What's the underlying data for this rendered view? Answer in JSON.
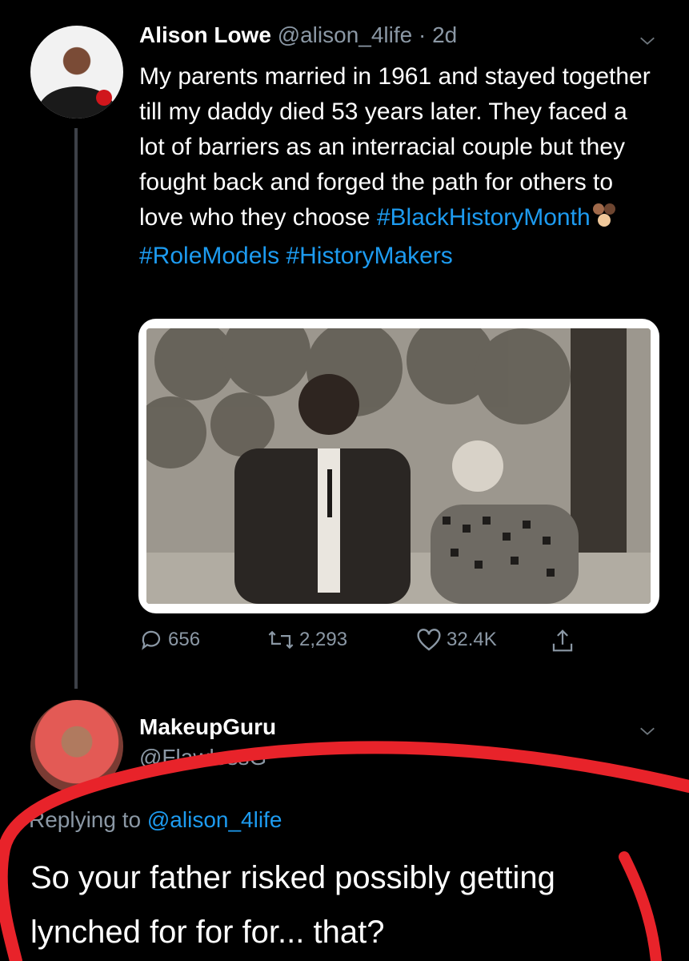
{
  "tweet": {
    "author_name": "Alison Lowe",
    "handle": "@alison_4life",
    "time": "· 2d",
    "text_before": "My parents married in 1961 and stayed together till my daddy died 53 years later. They faced a lot of barriers as an interracial couple but they fought back and forged the path for others to love who they choose ",
    "hashtag1": "#BlackHistoryMonth",
    "emoji": "✊🏾",
    "hashtag2": "#RoleModels",
    "hashtag3": "#HistoryMakers",
    "replies": "656",
    "retweets": "2,293",
    "likes": "32.4K"
  },
  "reply": {
    "author_name": "MakeupGuru",
    "handle": "@FlawlessG",
    "replying_prefix": "Replying to ",
    "replying_handle": "@alison_4life",
    "text": "So your father risked possibly getting lynched for for for... that?"
  },
  "colors": {
    "background": "#000000",
    "link": "#1d9bf0",
    "muted": "#8b98a5",
    "annotation": "#e8232a"
  },
  "icons": [
    "chevron-down-icon",
    "reply-icon",
    "retweet-icon",
    "like-icon",
    "share-icon"
  ]
}
